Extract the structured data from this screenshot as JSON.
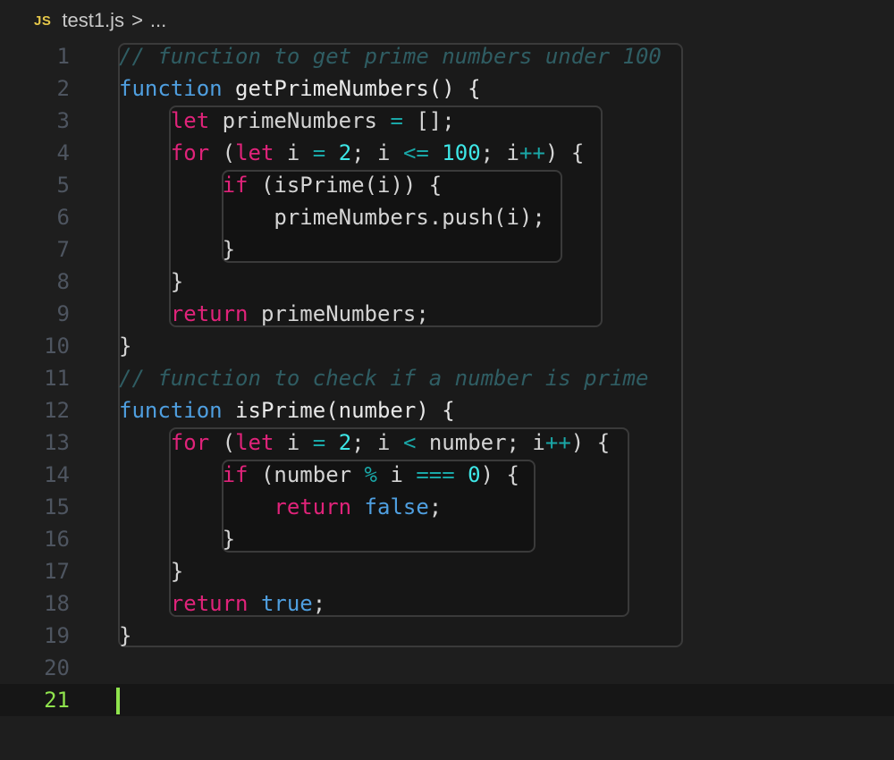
{
  "breadcrumb": {
    "file_icon": "JS",
    "file_name": "test1.js",
    "separator": ">",
    "ellipsis": "..."
  },
  "editor": {
    "current_line": 21,
    "lines": [
      {
        "n": "1"
      },
      {
        "n": "2"
      },
      {
        "n": "3"
      },
      {
        "n": "4"
      },
      {
        "n": "5"
      },
      {
        "n": "6"
      },
      {
        "n": "7"
      },
      {
        "n": "8"
      },
      {
        "n": "9"
      },
      {
        "n": "10"
      },
      {
        "n": "11"
      },
      {
        "n": "12"
      },
      {
        "n": "13"
      },
      {
        "n": "14"
      },
      {
        "n": "15"
      },
      {
        "n": "16"
      },
      {
        "n": "17"
      },
      {
        "n": "18"
      },
      {
        "n": "19"
      },
      {
        "n": "20"
      },
      {
        "n": "21"
      }
    ],
    "code": {
      "l1": [
        {
          "t": "// function to get prime numbers under 100",
          "c": "cm"
        }
      ],
      "l2": [
        {
          "t": "function",
          "c": "kw"
        },
        {
          "t": " getPrimeNumbers() {",
          "c": "fn"
        }
      ],
      "l3": [
        {
          "t": "    ",
          "c": "pl"
        },
        {
          "t": "let",
          "c": "kp"
        },
        {
          "t": " primeNumbers ",
          "c": "pl"
        },
        {
          "t": "=",
          "c": "op"
        },
        {
          "t": " [];",
          "c": "pl"
        }
      ],
      "l4": [
        {
          "t": "    ",
          "c": "pl"
        },
        {
          "t": "for",
          "c": "kp"
        },
        {
          "t": " (",
          "c": "pl"
        },
        {
          "t": "let",
          "c": "kp"
        },
        {
          "t": " i ",
          "c": "pl"
        },
        {
          "t": "=",
          "c": "op"
        },
        {
          "t": " ",
          "c": "pl"
        },
        {
          "t": "2",
          "c": "num"
        },
        {
          "t": "; i ",
          "c": "pl"
        },
        {
          "t": "<=",
          "c": "op"
        },
        {
          "t": " ",
          "c": "pl"
        },
        {
          "t": "100",
          "c": "num"
        },
        {
          "t": "; i",
          "c": "pl"
        },
        {
          "t": "++",
          "c": "op"
        },
        {
          "t": ") {",
          "c": "pl"
        }
      ],
      "l5": [
        {
          "t": "        ",
          "c": "pl"
        },
        {
          "t": "if",
          "c": "kp"
        },
        {
          "t": " (isPrime(i)) {",
          "c": "pl"
        }
      ],
      "l6": [
        {
          "t": "            primeNumbers.push(i);",
          "c": "pl"
        }
      ],
      "l7": [
        {
          "t": "        }",
          "c": "pl"
        }
      ],
      "l8": [
        {
          "t": "    }",
          "c": "pl"
        }
      ],
      "l9": [
        {
          "t": "    ",
          "c": "pl"
        },
        {
          "t": "return",
          "c": "kp"
        },
        {
          "t": " primeNumbers;",
          "c": "pl"
        }
      ],
      "l10": [
        {
          "t": "}",
          "c": "pl"
        }
      ],
      "l11": [
        {
          "t": "// function to check if a number is prime",
          "c": "cm"
        }
      ],
      "l12": [
        {
          "t": "function",
          "c": "kw"
        },
        {
          "t": " isPrime(number) {",
          "c": "fn"
        }
      ],
      "l13": [
        {
          "t": "    ",
          "c": "pl"
        },
        {
          "t": "for",
          "c": "kp"
        },
        {
          "t": " (",
          "c": "pl"
        },
        {
          "t": "let",
          "c": "kp"
        },
        {
          "t": " i ",
          "c": "pl"
        },
        {
          "t": "=",
          "c": "op"
        },
        {
          "t": " ",
          "c": "pl"
        },
        {
          "t": "2",
          "c": "num"
        },
        {
          "t": "; i ",
          "c": "pl"
        },
        {
          "t": "<",
          "c": "op"
        },
        {
          "t": " number; i",
          "c": "pl"
        },
        {
          "t": "++",
          "c": "op"
        },
        {
          "t": ") {",
          "c": "pl"
        }
      ],
      "l14": [
        {
          "t": "        ",
          "c": "pl"
        },
        {
          "t": "if",
          "c": "kp"
        },
        {
          "t": " (number ",
          "c": "pl"
        },
        {
          "t": "%",
          "c": "op"
        },
        {
          "t": " i ",
          "c": "pl"
        },
        {
          "t": "===",
          "c": "op"
        },
        {
          "t": " ",
          "c": "pl"
        },
        {
          "t": "0",
          "c": "num"
        },
        {
          "t": ") {",
          "c": "pl"
        }
      ],
      "l15": [
        {
          "t": "            ",
          "c": "pl"
        },
        {
          "t": "return",
          "c": "kp"
        },
        {
          "t": " ",
          "c": "pl"
        },
        {
          "t": "false",
          "c": "kw"
        },
        {
          "t": ";",
          "c": "pl"
        }
      ],
      "l16": [
        {
          "t": "        }",
          "c": "pl"
        }
      ],
      "l17": [
        {
          "t": "    }",
          "c": "pl"
        }
      ],
      "l18": [
        {
          "t": "    ",
          "c": "pl"
        },
        {
          "t": "return",
          "c": "kp"
        },
        {
          "t": " ",
          "c": "pl"
        },
        {
          "t": "true",
          "c": "kw"
        },
        {
          "t": ";",
          "c": "pl"
        }
      ],
      "l19": [
        {
          "t": "}",
          "c": "pl"
        }
      ],
      "l20": [],
      "l21": []
    }
  }
}
